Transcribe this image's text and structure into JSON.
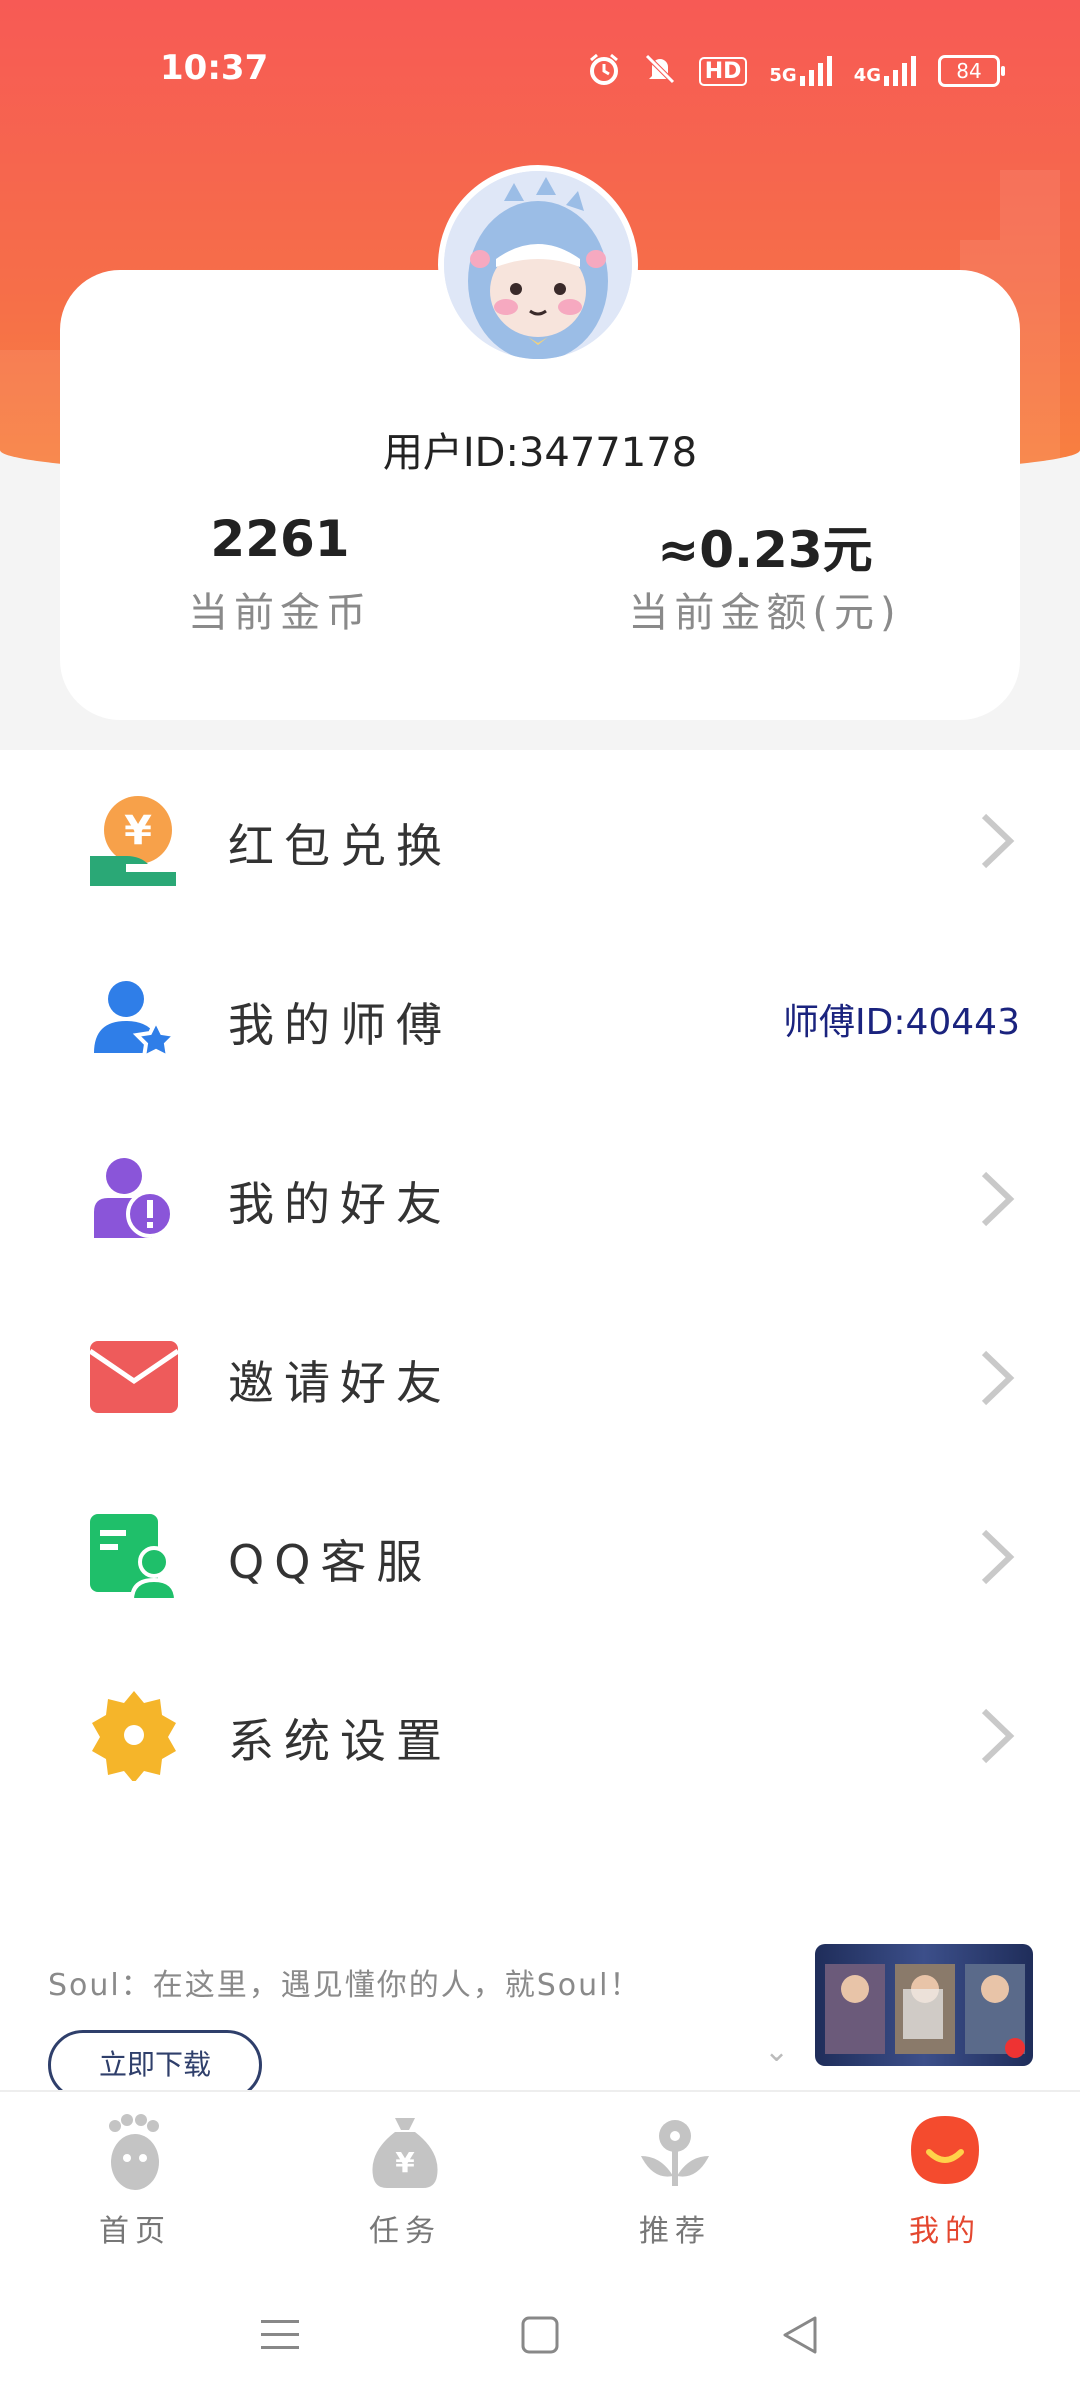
{
  "status_bar": {
    "time": "10:37",
    "icons": [
      "alarm-icon",
      "mute-icon",
      "hd-icon",
      "5g-signal-icon",
      "4g-signal-icon"
    ],
    "hd": "HD",
    "net_5g": "5G",
    "net_4g": "4G",
    "battery": "84"
  },
  "profile": {
    "user_id": "用户ID:3477178",
    "coins_value": "2261",
    "coins_label": "当前金币",
    "amount_value": "≈0.23元",
    "amount_label": "当前金额(元)"
  },
  "menu": {
    "items": [
      {
        "label": "红包兑换",
        "icon": "red-envelope-exchange-icon"
      },
      {
        "label": "我的师傅",
        "icon": "mentor-icon",
        "value": "师傅ID:40443"
      },
      {
        "label": "我的好友",
        "icon": "friends-icon"
      },
      {
        "label": "邀请好友",
        "icon": "invite-envelope-icon"
      },
      {
        "label": "QQ客服",
        "icon": "customer-service-icon"
      },
      {
        "label": "系统设置",
        "icon": "settings-gear-icon"
      }
    ]
  },
  "ad": {
    "text": "Soul：在这里，遇见懂你的人，就Soul！",
    "button": "立即下载"
  },
  "bottom_nav": {
    "items": [
      {
        "label": "首页",
        "icon": "home-icon"
      },
      {
        "label": "任务",
        "icon": "task-moneybag-icon"
      },
      {
        "label": "推荐",
        "icon": "recommend-icon"
      },
      {
        "label": "我的",
        "icon": "profile-icon",
        "active": true
      }
    ]
  },
  "colors": {
    "header_gradient_start": "#f75a55",
    "header_gradient_end": "#f8813f",
    "active_nav": "#e4472f",
    "mentor_id": "#1a237e"
  }
}
